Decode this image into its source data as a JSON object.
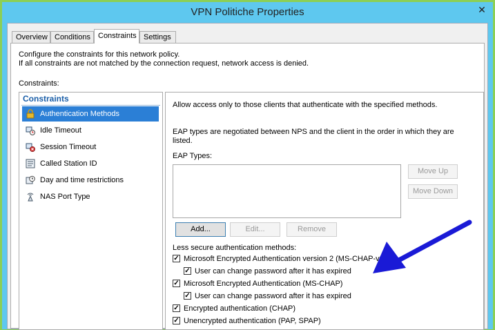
{
  "window": {
    "title": "VPN Politiche Properties",
    "close_glyph": "✕"
  },
  "tabs": [
    {
      "label": "Overview"
    },
    {
      "label": "Conditions"
    },
    {
      "label": "Constraints"
    },
    {
      "label": "Settings"
    }
  ],
  "description": {
    "line1": "Configure the constraints for this network policy.",
    "line2": "If all constraints are not matched by the connection request, network access is denied."
  },
  "constraints_label": "Constraints:",
  "list": {
    "header": "Constraints",
    "items": [
      {
        "label": "Authentication Methods",
        "icon": "lock-icon",
        "selected": true
      },
      {
        "label": "Idle Timeout",
        "icon": "idle-timeout-icon",
        "selected": false
      },
      {
        "label": "Session Timeout",
        "icon": "session-timeout-icon",
        "selected": false
      },
      {
        "label": "Called Station ID",
        "icon": "station-id-icon",
        "selected": false
      },
      {
        "label": "Day and time restrictions",
        "icon": "clock-icon",
        "selected": false
      },
      {
        "label": "NAS Port Type",
        "icon": "port-type-icon",
        "selected": false
      }
    ]
  },
  "auth_panel": {
    "intro": "Allow access only to those clients that authenticate with the specified methods.",
    "eap_note_line1": "EAP types are negotiated between NPS and the client in the order in which they are",
    "eap_note_line2": "listed.",
    "eap_types_label": "EAP Types:",
    "move_up": "Move Up",
    "move_down": "Move Down",
    "add": "Add...",
    "edit": "Edit...",
    "remove": "Remove",
    "less_secure_label": "Less secure authentication methods:",
    "methods": [
      {
        "label": "Microsoft Encrypted Authentication version 2 (MS-CHAP-v2)",
        "checked": true
      },
      {
        "label": "User can change password after it has expired",
        "checked": true
      },
      {
        "label": "Microsoft Encrypted Authentication (MS-CHAP)",
        "checked": true
      },
      {
        "label": "User can change password after it has expired",
        "checked": true
      },
      {
        "label": "Encrypted authentication (CHAP)",
        "checked": true
      },
      {
        "label": "Unencrypted authentication (PAP, SPAP)",
        "checked": true
      }
    ]
  },
  "colors": {
    "title_bar": "#5ec8ef",
    "frame": "#8ccf55",
    "selection": "#2b7fd6",
    "annotation_arrow": "#1a1ad6"
  }
}
